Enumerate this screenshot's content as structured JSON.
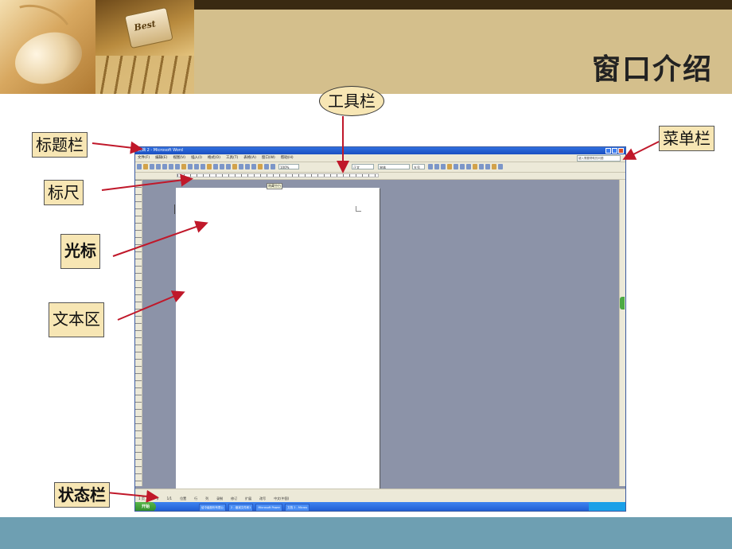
{
  "slide": {
    "title": "窗口介绍",
    "header_key_text": "Best"
  },
  "callouts": {
    "toolbar": "工具栏",
    "titlebar": "标题栏",
    "menubar": "菜单栏",
    "ruler": "标尺",
    "cursor": "光标",
    "text_area": "文本区",
    "statusbar": "状态栏"
  },
  "word_window": {
    "title": "文档 2 - Microsoft Word",
    "menu_items": [
      "文件(F)",
      "编辑(E)",
      "视图(V)",
      "插入(I)",
      "格式(O)",
      "工具(T)",
      "表格(A)",
      "窗口(W)",
      "帮助(H)"
    ],
    "help_placeholder": "键入需要帮助的问题",
    "toolbar": {
      "zoom": "100%",
      "style": "正文",
      "font": "宋体",
      "size": "五号"
    },
    "tooltip": "隐藏空白",
    "status": [
      "1 页",
      "1 节",
      "1/1",
      "位置",
      "行",
      "列",
      "录制",
      "修订",
      "扩展",
      "改写",
      "中文(中国)"
    ],
    "taskbar": {
      "start": "开始",
      "items": [
        "给中级股份有限公",
        "2 - 缩减文件和1",
        "Microsoft Power",
        "文档 2 - Micros"
      ]
    }
  },
  "colors": {
    "header_band": "#d4bf8c",
    "callout_fill": "#f7e6b4",
    "arrow": "#c0182a",
    "bottom_strip": "#6e9fb2"
  }
}
